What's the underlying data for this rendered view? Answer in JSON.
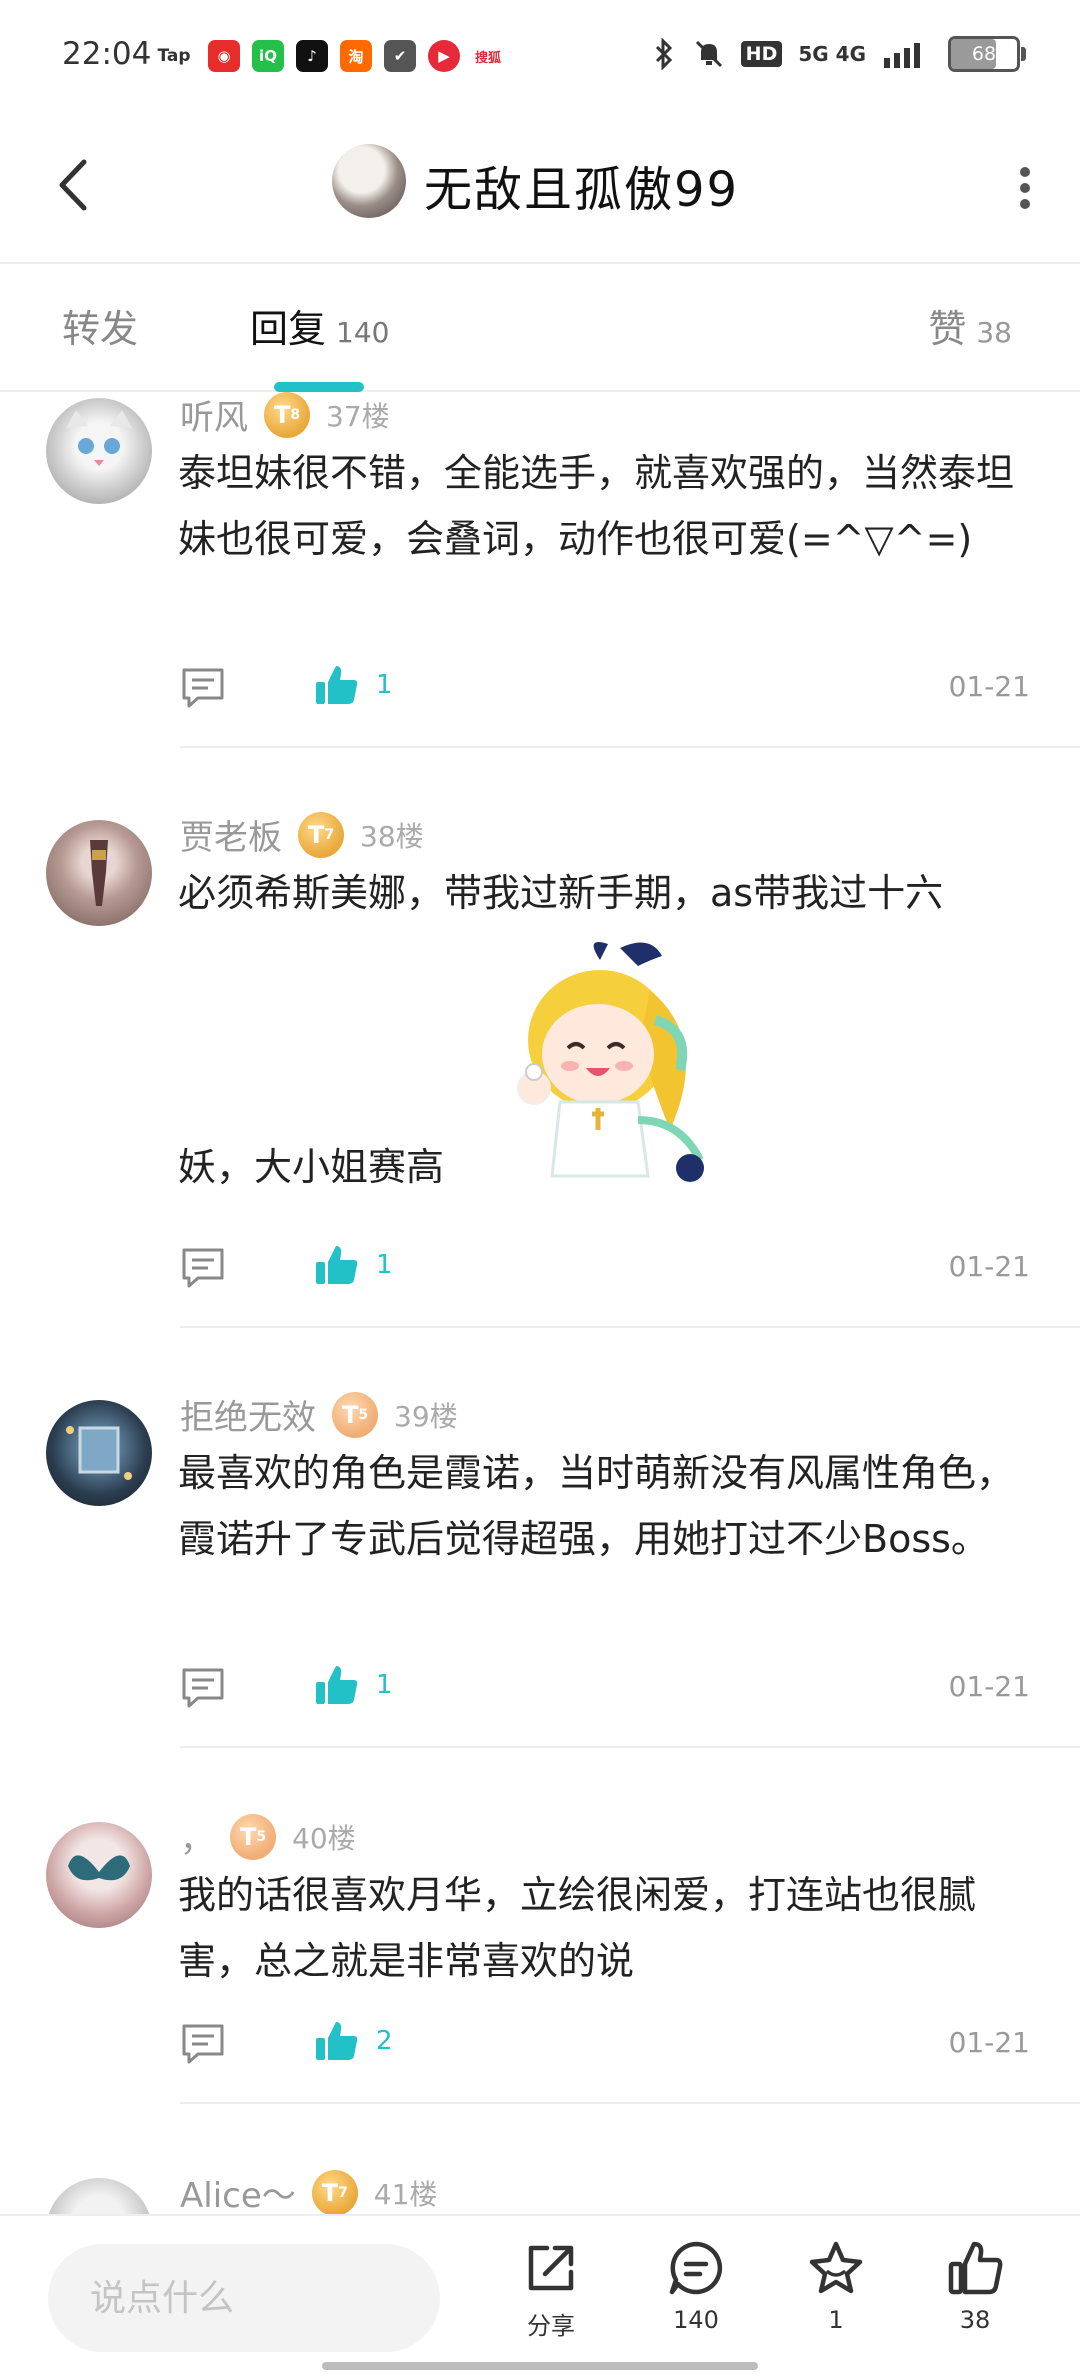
{
  "status_bar": {
    "time": "22:04",
    "apps": [
      {
        "name": "taptap",
        "label": "Tap",
        "color": "#ffffff",
        "text_color": "#333333"
      },
      {
        "name": "netease-music",
        "label": "◉",
        "color": "#e72d2c",
        "text_color": "#ffffff"
      },
      {
        "name": "iqiyi",
        "label": "iQ",
        "color": "#24c04a",
        "text_color": "#ffffff"
      },
      {
        "name": "douyin",
        "label": "♪",
        "color": "#111111",
        "text_color": "#ffffff"
      },
      {
        "name": "taobao",
        "label": "淘",
        "color": "#ff6a00",
        "text_color": "#ffffff"
      },
      {
        "name": "shield",
        "label": "✔",
        "color": "#555555",
        "text_color": "#ffffff"
      },
      {
        "name": "video-app",
        "label": "▶",
        "color": "#e62a3a",
        "text_color": "#ffffff"
      },
      {
        "name": "sohu-video",
        "label": "搜狐",
        "color": "#ffffff",
        "text_color": "#e62a3a"
      }
    ],
    "network": "5G 4G",
    "hd_label": "HD",
    "battery_level": 68,
    "battery_text": "68"
  },
  "header": {
    "title": "无敌且孤傲99"
  },
  "tabs": {
    "forward_label": "转发",
    "reply_label": "回复",
    "reply_count": "140",
    "likes_label": "赞",
    "likes_count": "38"
  },
  "comments": [
    {
      "name": "听风",
      "badge": "8",
      "floor": "37楼",
      "text": "泰坦妹很不错，全能选手，就喜欢强的，当然泰坦妹也很可爱，会叠词，动作也很可爱(=^▽^=)",
      "likes": "1",
      "date": "01-21"
    },
    {
      "name": "贾老板",
      "badge": "7",
      "floor": "38楼",
      "text_line1": "必须希斯美娜，带我过新手期，as带我过十六",
      "text_line2": "妖，大小姐赛高",
      "likes": "1",
      "date": "01-21"
    },
    {
      "name": "拒绝无效",
      "badge": "5",
      "floor": "39楼",
      "text": "最喜欢的角色是霞诺，当时萌新没有风属性角色，霞诺升了专武后觉得超强，用她打过不少Boss。",
      "likes": "1",
      "date": "01-21"
    },
    {
      "name": "，",
      "badge": "5",
      "floor": "40楼",
      "text": "我的话很喜欢月华，立绘很闲爱，打连站也很腻害，总之就是非常喜欢的说",
      "likes": "2",
      "date": "01-21"
    },
    {
      "name": "Alice～",
      "badge": "7",
      "floor": "41楼"
    }
  ],
  "bottom_bar": {
    "input_placeholder": "说点什么",
    "share_label": "分享",
    "comment_count": "140",
    "star_count": "1",
    "like_count": "38"
  },
  "colors": {
    "accent": "#22c1c7",
    "badge_gold": "#e9a83a"
  }
}
